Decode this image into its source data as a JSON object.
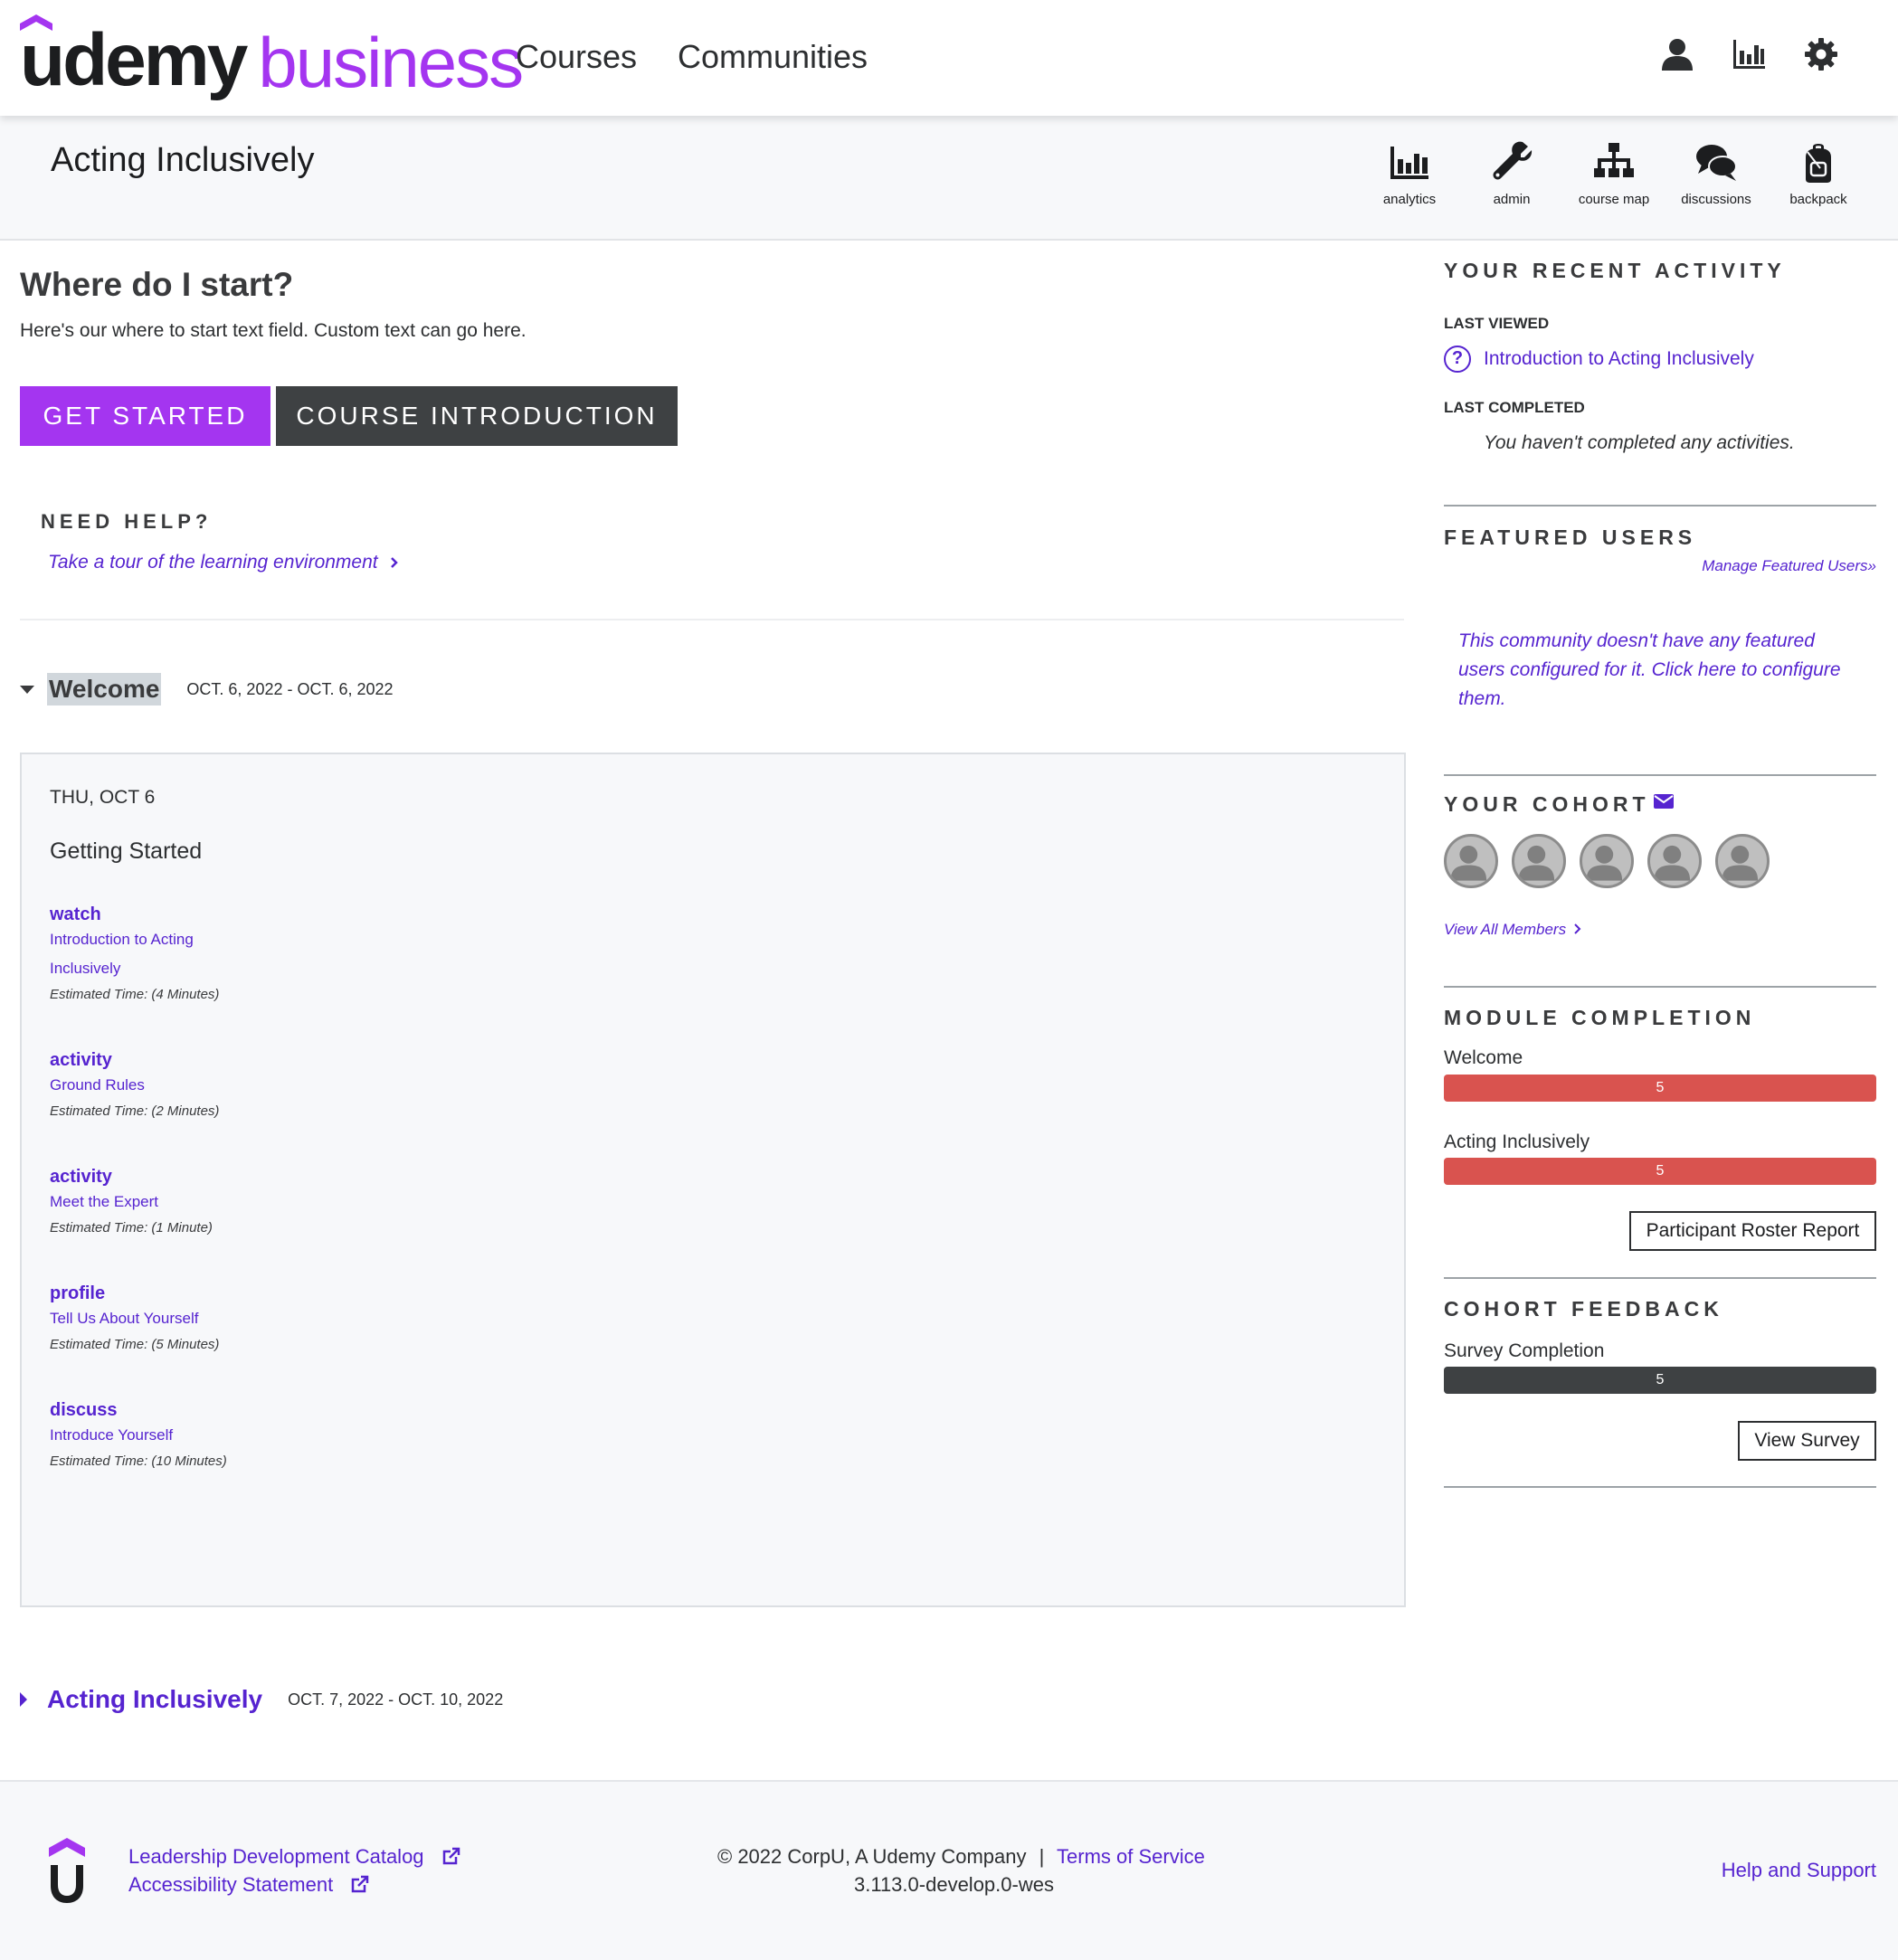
{
  "header": {
    "logo_udemy": "udemy",
    "logo_business": "business",
    "nav": [
      "Courses",
      "Communities"
    ]
  },
  "course": {
    "title": "Acting Inclusively",
    "tools": [
      {
        "label": "analytics",
        "icon": "bar-chart-icon"
      },
      {
        "label": "admin",
        "icon": "wrench-icon"
      },
      {
        "label": "course map",
        "icon": "sitemap-icon"
      },
      {
        "label": "discussions",
        "icon": "comments-icon"
      },
      {
        "label": "backpack",
        "icon": "backpack-icon"
      }
    ]
  },
  "start": {
    "heading": "Where do I start?",
    "text": "Here's our where to start text field. Custom text can go here.",
    "get_started": "GET STARTED",
    "course_intro": "COURSE INTRODUCTION"
  },
  "help": {
    "heading": "NEED HELP?",
    "tour_link": "Take a tour of the learning environment"
  },
  "sections": [
    {
      "title": "Welcome",
      "dates": "OCT. 6, 2022 - OCT. 6, 2022",
      "day": "THU, OCT 6",
      "group": "Getting Started",
      "activities": [
        {
          "type": "watch",
          "name": "Introduction to Acting Inclusively",
          "time": "Estimated Time: (4 Minutes)"
        },
        {
          "type": "activity",
          "name": "Ground Rules",
          "time": "Estimated Time: (2 Minutes)"
        },
        {
          "type": "activity",
          "name": "Meet the Expert",
          "time": "Estimated Time: (1 Minute)"
        },
        {
          "type": "profile",
          "name": "Tell Us About Yourself",
          "time": "Estimated Time: (5 Minutes)"
        },
        {
          "type": "discuss",
          "name": "Introduce Yourself",
          "time": "Estimated Time: (10 Minutes)"
        }
      ]
    },
    {
      "title": "Acting Inclusively",
      "dates": "OCT. 7, 2022 - OCT. 10, 2022"
    }
  ],
  "sidebar": {
    "recent": {
      "heading": "YOUR RECENT ACTIVITY",
      "last_viewed_label": "LAST VIEWED",
      "last_viewed_item": "Introduction to Acting Inclusively",
      "last_completed_label": "LAST COMPLETED",
      "last_completed_text": "You haven't completed any activities."
    },
    "featured": {
      "heading": "FEATURED USERS",
      "manage_link": "Manage Featured Users»",
      "empty_text": "This community doesn't have any featured users configured for it. Click here to configure them."
    },
    "cohort": {
      "heading": "YOUR COHORT",
      "member_count_shown": 5,
      "view_all": "View All Members"
    },
    "module_completion": {
      "heading": "MODULE COMPLETION",
      "modules": [
        {
          "name": "Welcome",
          "value": "5",
          "color": "#d9534f"
        },
        {
          "name": "Acting Inclusively",
          "value": "5",
          "color": "#d9534f"
        }
      ],
      "roster_button": "Participant Roster Report"
    },
    "feedback": {
      "heading": "COHORT FEEDBACK",
      "label": "Survey Completion",
      "value": "5",
      "color": "#3e4143",
      "button": "View Survey"
    }
  },
  "footer": {
    "links_left": [
      "Leadership Development Catalog",
      "Accessibility Statement"
    ],
    "copyright": "© 2022 CorpU, A Udemy Company",
    "separator": "|",
    "terms": "Terms of Service",
    "version": "3.113.0-develop.0-wes",
    "help": "Help and Support"
  },
  "colors": {
    "brand_purple": "#a435f0",
    "link_purple": "#5624d0",
    "dark_button": "#3e4143",
    "progress_red": "#d9534f"
  }
}
